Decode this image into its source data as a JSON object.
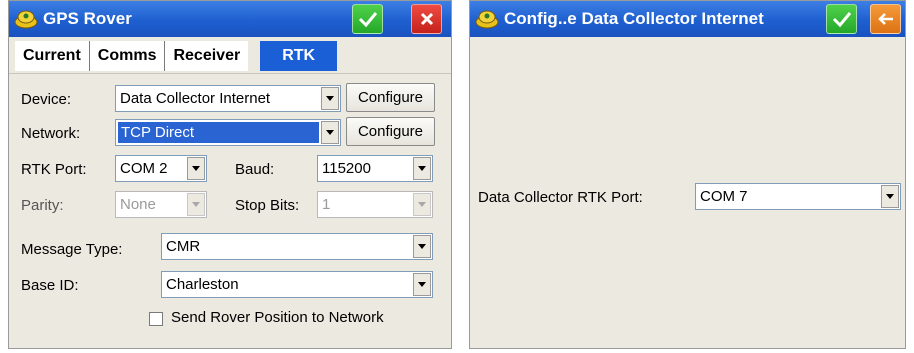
{
  "left_window": {
    "title": "GPS Rover",
    "tabs": [
      {
        "label": "Current"
      },
      {
        "label": "Comms"
      },
      {
        "label": "Receiver"
      },
      {
        "label": "RTK"
      }
    ],
    "device": {
      "label": "Device:",
      "value": "Data Collector Internet",
      "button": "Configure"
    },
    "network": {
      "label": "Network:",
      "value": "TCP Direct",
      "button": "Configure"
    },
    "rtk_port": {
      "label": "RTK Port:",
      "value": "COM 2"
    },
    "baud": {
      "label": "Baud:",
      "value": "115200"
    },
    "parity": {
      "label": "Parity:",
      "value": "None"
    },
    "stop_bits": {
      "label": "Stop Bits:",
      "value": "1"
    },
    "message_type": {
      "label": "Message Type:",
      "value": "CMR"
    },
    "base_id": {
      "label": "Base ID:",
      "value": "Charleston"
    },
    "send_position": {
      "label": "Send Rover Position to Network",
      "checked": false
    }
  },
  "right_window": {
    "title": "Config..e Data Collector Internet",
    "rtk_port": {
      "label": "Data Collector RTK Port:",
      "value": "COM 7"
    }
  },
  "colors": {
    "title_bar": "#1e5fd0",
    "ok_button": "#25a82a",
    "close_button": "#c4221a",
    "back_button": "#dd7214",
    "selection": "#2a63d2"
  },
  "icons": [
    "gps-rover-icon",
    "checkmark-icon",
    "close-icon",
    "back-arrow-icon",
    "dropdown-arrow-icon"
  ]
}
